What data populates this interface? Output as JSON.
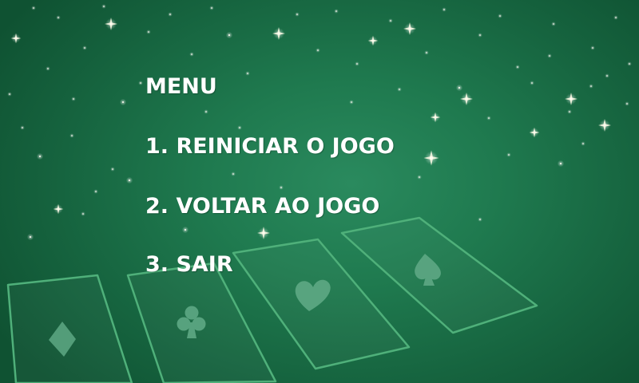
{
  "menu": {
    "title": "MENU",
    "options": [
      {
        "label": "1. REINICIAR O JOGO"
      },
      {
        "label": "2. VOLTAR AO JOGO"
      },
      {
        "label": "3. SAIR"
      }
    ]
  },
  "cards": [
    {
      "suit": "diamond-icon"
    },
    {
      "suit": "club-icon"
    },
    {
      "suit": "heart-icon"
    },
    {
      "suit": "spade-icon"
    }
  ],
  "colors": {
    "background": "#1f7a4f",
    "card_outline": "#4fb07a",
    "suit": "#5ea884",
    "text": "#ffffff"
  }
}
